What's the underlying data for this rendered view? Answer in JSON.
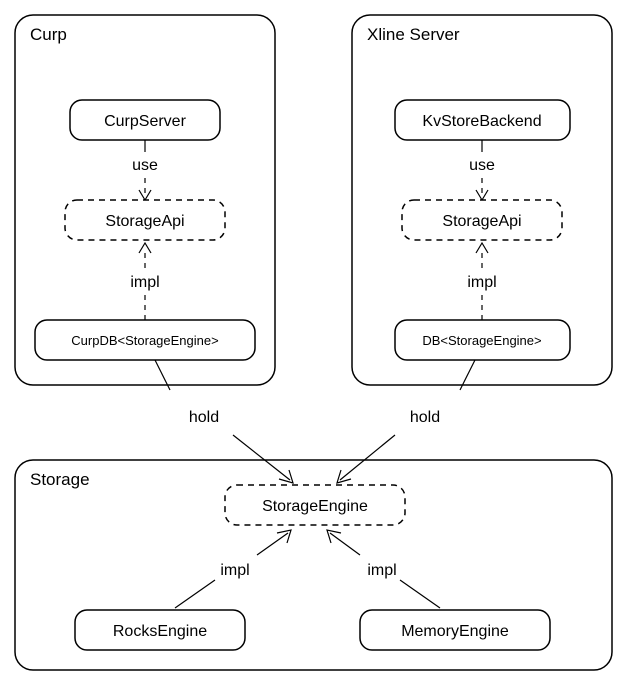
{
  "containers": {
    "curp": {
      "title": "Curp"
    },
    "xline": {
      "title": "Xline Server"
    },
    "storage": {
      "title": "Storage"
    }
  },
  "nodes": {
    "curpServer": "CurpServer",
    "storageApi1": "StorageApi",
    "curpDB": "CurpDB<StorageEngine>",
    "kvStoreBackend": "KvStoreBackend",
    "storageApi2": "StorageApi",
    "db": "DB<StorageEngine>",
    "storageEngine": "StorageEngine",
    "rocksEngine": "RocksEngine",
    "memoryEngine": "MemoryEngine"
  },
  "edges": {
    "use1": "use",
    "impl1": "impl",
    "use2": "use",
    "impl2": "impl",
    "hold1": "hold",
    "hold2": "hold",
    "impl3": "impl",
    "impl4": "impl"
  }
}
